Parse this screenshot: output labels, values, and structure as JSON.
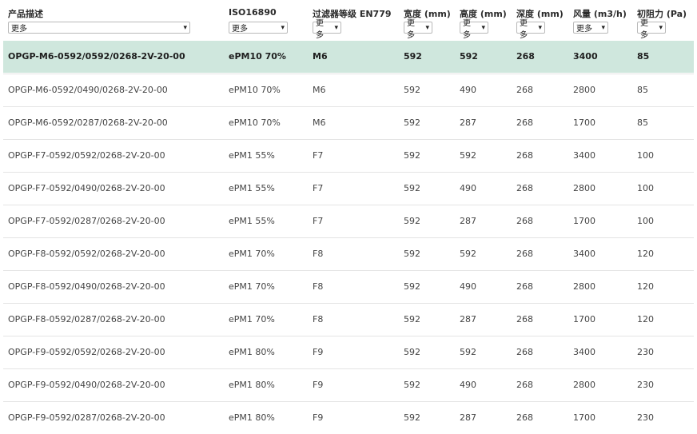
{
  "table": {
    "columns": [
      {
        "key": "desc",
        "title": "产品描述",
        "filter": "更多"
      },
      {
        "key": "iso",
        "title": "ISO16890",
        "filter": "更多"
      },
      {
        "key": "en",
        "title": "过滤器等级 EN779",
        "filter": "更多"
      },
      {
        "key": "w",
        "title": "宽度 (mm)",
        "filter": "更多"
      },
      {
        "key": "h",
        "title": "高度 (mm)",
        "filter": "更多"
      },
      {
        "key": "d",
        "title": "深度 (mm)",
        "filter": "更多"
      },
      {
        "key": "flow",
        "title": "风量 (m3/h)",
        "filter": "更多"
      },
      {
        "key": "pa",
        "title": "初阻力 (Pa)",
        "filter": "更多"
      }
    ],
    "rows": [
      {
        "desc": "OPGP-M6-0592/0592/0268-2V-20-00",
        "iso": "ePM10 70%",
        "en": "M6",
        "w": "592",
        "h": "592",
        "d": "268",
        "flow": "3400",
        "pa": "85",
        "highlighted": true
      },
      {
        "desc": "OPGP-M6-0592/0490/0268-2V-20-00",
        "iso": "ePM10 70%",
        "en": "M6",
        "w": "592",
        "h": "490",
        "d": "268",
        "flow": "2800",
        "pa": "85"
      },
      {
        "desc": "OPGP-M6-0592/0287/0268-2V-20-00",
        "iso": "ePM10 70%",
        "en": "M6",
        "w": "592",
        "h": "287",
        "d": "268",
        "flow": "1700",
        "pa": "85"
      },
      {
        "desc": "OPGP-F7-0592/0592/0268-2V-20-00",
        "iso": "ePM1 55%",
        "en": "F7",
        "w": "592",
        "h": "592",
        "d": "268",
        "flow": "3400",
        "pa": "100"
      },
      {
        "desc": "OPGP-F7-0592/0490/0268-2V-20-00",
        "iso": "ePM1 55%",
        "en": "F7",
        "w": "592",
        "h": "490",
        "d": "268",
        "flow": "2800",
        "pa": "100"
      },
      {
        "desc": "OPGP-F7-0592/0287/0268-2V-20-00",
        "iso": "ePM1 55%",
        "en": "F7",
        "w": "592",
        "h": "287",
        "d": "268",
        "flow": "1700",
        "pa": "100"
      },
      {
        "desc": "OPGP-F8-0592/0592/0268-2V-20-00",
        "iso": "ePM1 70%",
        "en": "F8",
        "w": "592",
        "h": "592",
        "d": "268",
        "flow": "3400",
        "pa": "120"
      },
      {
        "desc": "OPGP-F8-0592/0490/0268-2V-20-00",
        "iso": "ePM1 70%",
        "en": "F8",
        "w": "592",
        "h": "490",
        "d": "268",
        "flow": "2800",
        "pa": "120"
      },
      {
        "desc": "OPGP-F8-0592/0287/0268-2V-20-00",
        "iso": "ePM1 70%",
        "en": "F8",
        "w": "592",
        "h": "287",
        "d": "268",
        "flow": "1700",
        "pa": "120"
      },
      {
        "desc": "OPGP-F9-0592/0592/0268-2V-20-00",
        "iso": "ePM1 80%",
        "en": "F9",
        "w": "592",
        "h": "592",
        "d": "268",
        "flow": "3400",
        "pa": "230"
      },
      {
        "desc": "OPGP-F9-0592/0490/0268-2V-20-00",
        "iso": "ePM1 80%",
        "en": "F9",
        "w": "592",
        "h": "490",
        "d": "268",
        "flow": "2800",
        "pa": "230"
      },
      {
        "desc": "OPGP-F9-0592/0287/0268-2V-20-00",
        "iso": "ePM1 80%",
        "en": "F9",
        "w": "592",
        "h": "287",
        "d": "268",
        "flow": "1700",
        "pa": "230"
      }
    ]
  },
  "colors": {
    "highlight_row": "#cfe7dd",
    "row_divider": "#e4e4e4"
  },
  "icons": {
    "dropdown": "chevron-down-icon"
  }
}
